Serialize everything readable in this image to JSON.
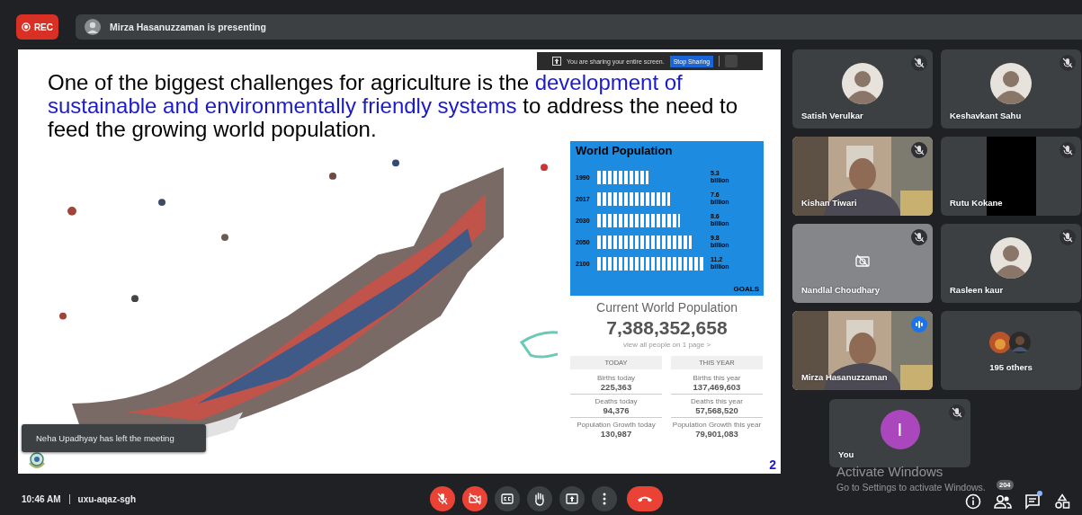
{
  "top_bar": {
    "record_label": "REC",
    "presenting": "Mirza Hasanuzzaman is presenting"
  },
  "slide": {
    "heading": [
      {
        "text": "One of the biggest challenges for agriculture is the ",
        "highlight": false
      },
      {
        "text": "development of sustainable and environmentally friendly systems",
        "highlight": true
      },
      {
        "text": " to address the need to feed the growing world population.",
        "highlight": false
      }
    ],
    "infographic": {
      "title": "World Population",
      "rows": [
        {
          "year": "1990",
          "value": "5.3",
          "unit": "billion"
        },
        {
          "year": "2017",
          "value": "7.6",
          "unit": "billion"
        },
        {
          "year": "2030",
          "value": "8.6",
          "unit": "billion"
        },
        {
          "year": "2050",
          "value": "9.8",
          "unit": "billion"
        },
        {
          "year": "2100",
          "value": "11.2",
          "unit": "billion"
        }
      ],
      "logo_text": "GOALS"
    },
    "counter": {
      "title": "Current World Population",
      "value": "7,388,352,658",
      "link": "view all people on 1 page >",
      "columns": [
        {
          "heading": "TODAY",
          "stats": [
            {
              "label": "Births today",
              "value": "225,363"
            },
            {
              "label": "Deaths today",
              "value": "94,376"
            },
            {
              "label": "Population Growth today",
              "value": "130,987"
            }
          ]
        },
        {
          "heading": "THIS YEAR",
          "stats": [
            {
              "label": "Births this year",
              "value": "137,469,603"
            },
            {
              "label": "Deaths this year",
              "value": "57,568,520"
            },
            {
              "label": "Population Growth this year",
              "value": "79,901,083"
            }
          ]
        }
      ]
    },
    "page_number": "2"
  },
  "sharing_bar": {
    "message": "You are sharing your entire screen.",
    "stop_button": "Stop Sharing"
  },
  "toast": "Neha Upadhyay has left the meeting",
  "participants": [
    {
      "name": "Satish Verulkar",
      "kind": "avatar",
      "muted": true,
      "speaking": false
    },
    {
      "name": "Keshavkant Sahu",
      "kind": "avatar",
      "muted": true,
      "speaking": false
    },
    {
      "name": "Kishan Tiwari",
      "kind": "video",
      "muted": true,
      "speaking": false
    },
    {
      "name": "Rutu Kokane",
      "kind": "blank",
      "muted": true,
      "speaking": false
    },
    {
      "name": "Nandlal Choudhary",
      "kind": "camera_off",
      "muted": true,
      "speaking": false
    },
    {
      "name": "Rasleen kaur",
      "kind": "avatar",
      "muted": true,
      "speaking": false
    },
    {
      "name": "Mirza Hasanuzzaman",
      "kind": "video",
      "muted": false,
      "speaking": true
    },
    {
      "name": "195 others",
      "kind": "others",
      "muted": false,
      "speaking": false
    }
  ],
  "self_tile": {
    "name": "You",
    "initial": "I",
    "muted": true
  },
  "bottom_bar": {
    "time": "10:46 AM",
    "meeting_code": "uxu-aqaz-sgh",
    "controls": [
      {
        "kind": "mic",
        "on": false
      },
      {
        "kind": "camera",
        "on": false
      },
      {
        "kind": "captions"
      },
      {
        "kind": "hand"
      },
      {
        "kind": "present"
      },
      {
        "kind": "more"
      },
      {
        "kind": "end"
      }
    ],
    "side": [
      {
        "kind": "info"
      },
      {
        "kind": "people",
        "badge": "204"
      },
      {
        "kind": "chat",
        "dot": true
      },
      {
        "kind": "activities"
      }
    ]
  },
  "os_overlay": {
    "title": "Activate Windows",
    "message": "Go to Settings to activate Windows."
  }
}
